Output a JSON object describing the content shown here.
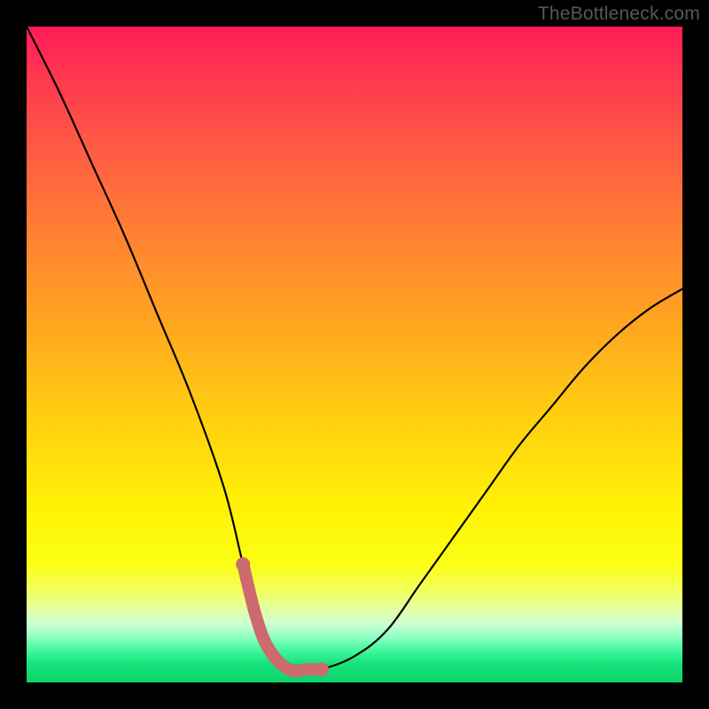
{
  "watermark": "TheBottleneck.com",
  "chart_data": {
    "type": "line",
    "title": "",
    "xlabel": "",
    "ylabel": "",
    "xlim": [
      0,
      100
    ],
    "ylim": [
      0,
      100
    ],
    "series": [
      {
        "name": "bottleneck-curve",
        "x": [
          0,
          5,
          10,
          15,
          20,
          25,
          30,
          33,
          35,
          37,
          40,
          43,
          45,
          50,
          55,
          60,
          65,
          70,
          75,
          80,
          85,
          90,
          95,
          100
        ],
        "values": [
          100,
          90,
          79,
          68,
          56,
          44,
          30,
          18,
          10,
          5,
          2,
          2,
          2,
          4,
          8,
          15,
          22,
          29,
          36,
          42,
          48,
          53,
          57,
          60
        ]
      }
    ],
    "highlight_segment": {
      "name": "trough-highlight",
      "x_start": 33,
      "x_end": 45
    },
    "gradient_stops": [
      {
        "pos": 0.0,
        "color": "#ff1a56"
      },
      {
        "pos": 0.18,
        "color": "#ff5944"
      },
      {
        "pos": 0.46,
        "color": "#ffa81f"
      },
      {
        "pos": 0.74,
        "color": "#fff305"
      },
      {
        "pos": 0.91,
        "color": "#ceffd4"
      },
      {
        "pos": 1.0,
        "color": "#0cd269"
      }
    ]
  }
}
